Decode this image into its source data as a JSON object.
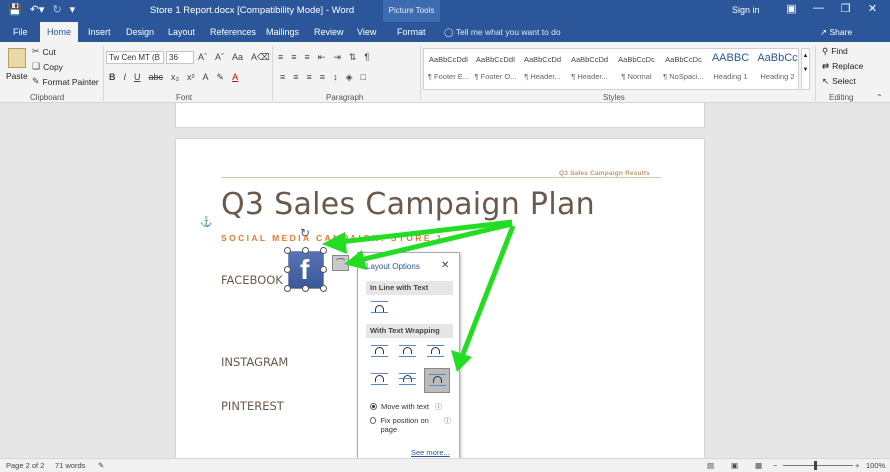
{
  "window": {
    "title": "Store 1 Report.docx [Compatibility Mode] - Word",
    "context_tab": "Picture Tools",
    "sign_in": "Sign in"
  },
  "qat": {
    "save_icon": "save-icon",
    "undo_icon": "undo-icon",
    "redo_icon": "redo-icon",
    "customize_icon": "customize-icon"
  },
  "tabs": [
    {
      "label": "File"
    },
    {
      "label": "Home",
      "active": true
    },
    {
      "label": "Insert"
    },
    {
      "label": "Design"
    },
    {
      "label": "Layout"
    },
    {
      "label": "References"
    },
    {
      "label": "Mailings"
    },
    {
      "label": "Review"
    },
    {
      "label": "View"
    },
    {
      "label": "Format"
    }
  ],
  "tell_me": "Tell me what you want to do",
  "share": "Share",
  "ribbon": {
    "clipboard": {
      "paste": "Paste",
      "cut": "Cut",
      "copy": "Copy",
      "format_painter": "Format Painter",
      "label": "Clipboard"
    },
    "font": {
      "name": "Tw Cen MT (B",
      "size": "36",
      "label": "Font"
    },
    "paragraph": {
      "label": "Paragraph"
    },
    "styles": {
      "label": "Styles",
      "items": [
        {
          "sample": "AaBbCcDdI",
          "name": "¶ Footer E..."
        },
        {
          "sample": "AaBbCcDdI",
          "name": "¶ Footer O..."
        },
        {
          "sample": "AaBbCcDd",
          "name": "¶ Header..."
        },
        {
          "sample": "AaBbCcDd",
          "name": "¶ Header..."
        },
        {
          "sample": "AaBbCcDc",
          "name": "¶ Normal"
        },
        {
          "sample": "AaBbCcDc",
          "name": "¶ NoSpaci..."
        },
        {
          "sample": "AABBC",
          "name": "Heading 1"
        },
        {
          "sample": "AaBbCc",
          "name": "Heading 2"
        }
      ]
    },
    "editing": {
      "find": "Find",
      "replace": "Replace",
      "select": "Select",
      "label": "Editing"
    }
  },
  "document": {
    "header_text": "Q3 Sales Campaign Results",
    "heading": "Q3 Sales Campaign Plan",
    "subheading": "SOCIAL MEDIA CAMPAIGN: STORE 1",
    "sections": [
      "FACEBOOK",
      "INSTAGRAM",
      "PINTEREST"
    ],
    "image_letter": "f"
  },
  "layout_options": {
    "title": "Layout Options",
    "inline_section": "In Line with Text",
    "wrap_section": "With Text Wrapping",
    "move_with_text": "Move with text",
    "fix_position": "Fix position on page",
    "see_more": "See more..."
  },
  "status": {
    "page": "Page 2 of 2",
    "words": "71 words",
    "zoom": "100%"
  },
  "colors": {
    "word_blue": "#2b579a",
    "arrow_green": "#22dd22",
    "heading_brown": "#6b5a4a",
    "sub_orange": "#e07a33"
  }
}
